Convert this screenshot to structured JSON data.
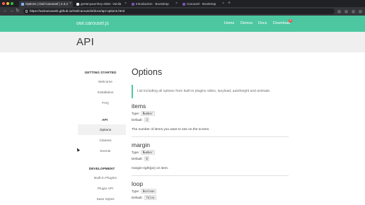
{
  "browser": {
    "tabs": [
      {
        "label": "Options | Owl Carousel | 2.3.4",
        "active": true
      },
      {
        "label": "gertanyaumhey-elder: Vanila",
        "active": false
      },
      {
        "label": "Introduction · Bootstrap",
        "active": false
      },
      {
        "label": "Carousel · Bootstrap",
        "active": false
      }
    ],
    "new_tab": "+",
    "url": "https://owlcarousel2.github.io/OwlCarousel2/docs/api-options.html"
  },
  "site": {
    "brand": "owl.carousel.js",
    "nav": [
      "Home",
      "Demos",
      "Docs",
      "Download"
    ],
    "download_badge": "6",
    "page_heading": "API"
  },
  "sidebar": {
    "sections": [
      {
        "heading": "GETTING STARTED",
        "items": [
          "Welcome",
          "Installation",
          "FAQ"
        ]
      },
      {
        "heading": "API",
        "items": [
          "Options",
          "Classes",
          "Events"
        ]
      },
      {
        "heading": "DEVELOPMENT",
        "items": [
          "Built-in Plugins",
          "Plugin API",
          "Sass Styles"
        ]
      }
    ],
    "active_item": "Options"
  },
  "main": {
    "title": "Options",
    "intro": "List including all options from built-in plugins video, lazyload, autoheight and animate.",
    "type_label": "Type:",
    "default_label": "Default:",
    "options": [
      {
        "name": "items",
        "type": "Number",
        "default": "3",
        "desc": "The number of items you want to see on the screen."
      },
      {
        "name": "margin",
        "type": "Number",
        "default": "0",
        "desc": "margin-right(px) on item."
      },
      {
        "name": "loop",
        "type": "Boolean",
        "default": "false",
        "desc": ""
      }
    ]
  },
  "colors": {
    "accent": "#4dc7a0",
    "badge": "#e54c4c",
    "chrome": "#202124"
  }
}
